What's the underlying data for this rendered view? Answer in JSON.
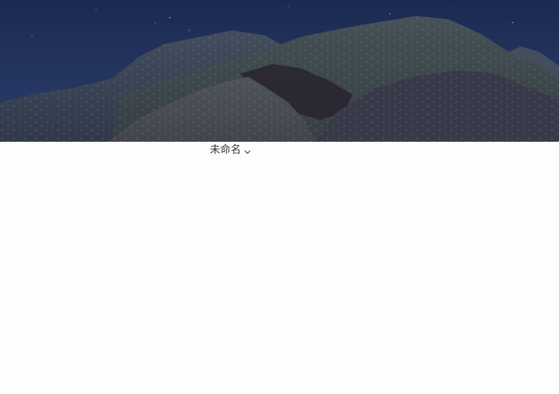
{
  "banner": {
    "image_name": "mountain-night-landscape"
  },
  "document": {
    "title": "未命名",
    "dropdown_icon": "chevron-down-icon"
  },
  "colors": {
    "page_background": "#fdfdfd",
    "title_text": "#3a3a3a",
    "sky_top": "#1b2a52",
    "sky_bottom": "#2c4270"
  }
}
